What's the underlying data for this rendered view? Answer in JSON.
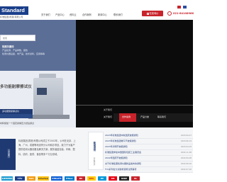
{
  "header": {
    "logo_text": "Standard",
    "company_name": "标准集团(香港)有限公司",
    "nav": [
      "关于我们",
      "产品中心",
      "资料云",
      "合作案例",
      "新闻中心",
      "联系我们"
    ],
    "cta_label": "在线询价",
    "phone": "021-64108966",
    "flags": [
      "中文",
      "English"
    ],
    "accent_color": "#c8232b",
    "brand_color": "#1a3f8a"
  },
  "left_panel": {
    "search_placeholder": "搜索",
    "hot_title": "热搜关键词",
    "hot_lines": [
      "产品检测、产品参数、报告",
      "检测仪器设备、非产品、技术资料、应用等等"
    ],
    "product_title": "多功能耐摩擦试仪",
    "caption": "多功能耐摩擦试仪",
    "subcaption": "材料施加一个固定摩擦压力然后通过"
  },
  "banner": {
    "label": "关于我们",
    "sub_tabs": [
      "关于我们",
      "合作案例",
      "产品分类",
      "联系我们"
    ],
    "active_tab": 1
  },
  "about": {
    "card_label": "公司简介",
    "text": "标准集团(香港)有限公司成立于2002年，公司在北京、上海、广州、成都等地设有分公司和办事处，致力于为客户提供检测仪器设备及解决方案，服务涵盖包装、印刷、塑料、纺织、医药、食品等多个行业领域。"
  },
  "news": {
    "card_label": "新闻资讯",
    "more_label": "查看更多",
    "items": [
      {
        "title": "2023年标准集团中秋国庆放假通知",
        "date": "2023-09-27"
      },
      {
        "title": "2023年标准集团端午节放假通知",
        "date": "2023-06-19"
      },
      {
        "title": "2023年清明节放假通知",
        "date": "2023-04-03"
      },
      {
        "title": "标准集团参加中国国际包装工业展览会",
        "date": "2022-11-28"
      },
      {
        "title": "2022年国庆节放假通知",
        "date": "2022-09-28"
      },
      {
        "title": "关于标准集团检测仪器新品发布的通知",
        "date": "2022-08-16"
      },
      {
        "title": "FYA系列拉力试验机使用注意事项",
        "date": "2022-07-20"
      }
    ]
  },
  "partners": [
    "SIEMENS",
    "TÜV",
    "SGS",
    "Intertek",
    "PHILIPS",
    "Pfizer",
    "BV",
    "DHL",
    "HP",
    "3M",
    "NIKE",
    "UL"
  ]
}
